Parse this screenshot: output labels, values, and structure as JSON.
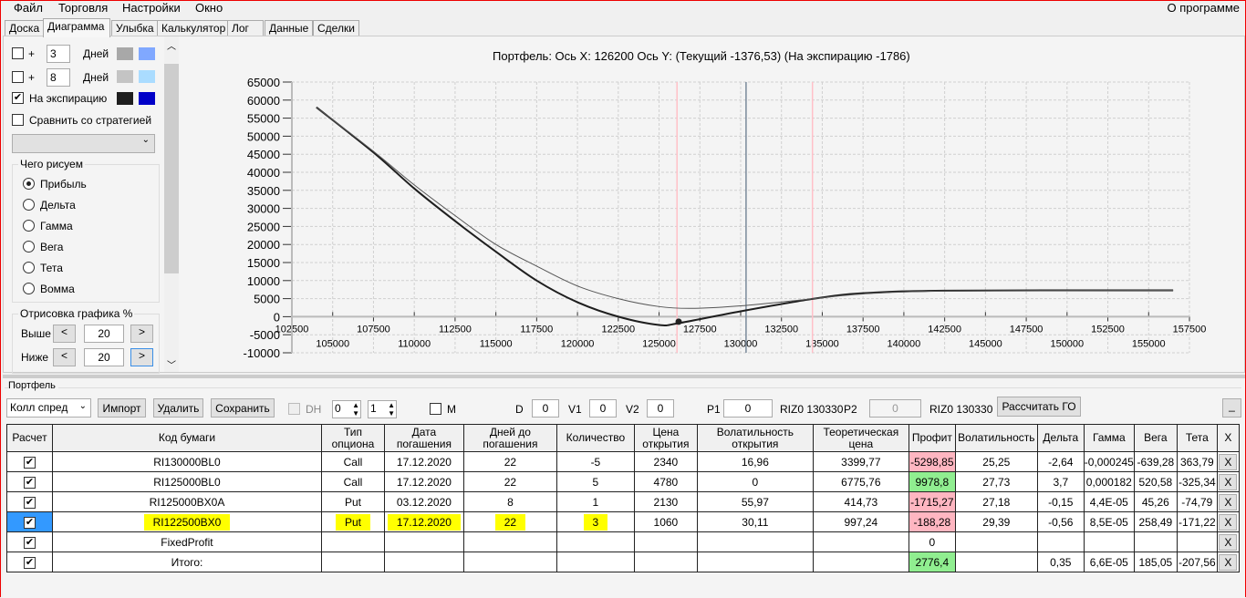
{
  "menu": {
    "items": [
      "Файл",
      "Торговля",
      "Настройки",
      "Окно"
    ],
    "about": "О программе"
  },
  "tabs": [
    "Доска",
    "Диаграмма",
    "Улыбка",
    "Калькулятор",
    "Лог",
    "Данные",
    "Сделки"
  ],
  "left": {
    "row1": {
      "checked": false,
      "plus": "+",
      "days": "3",
      "days_label": "Дней",
      "colors": [
        "#a8a8a8",
        "#80a8ff"
      ]
    },
    "row2": {
      "checked": false,
      "plus": "+",
      "days": "8",
      "days_label": "Дней",
      "colors": [
        "#c4c4c4",
        "#aadcff"
      ]
    },
    "expiration": {
      "checked": true,
      "label": "На экспирацию",
      "colors": [
        "#1e1e1e",
        "#0000c8"
      ]
    },
    "compare": {
      "checked": false,
      "label": "Сравнить со стратегией"
    },
    "strategy_select": "",
    "draw_group": "Чего рисуем",
    "draw_options": [
      "Прибыль",
      "Дельта",
      "Гамма",
      "Вега",
      "Тета",
      "Вомма"
    ],
    "draw_selected": 0,
    "range_group": "Отрисовка графика %",
    "above_label": "Выше",
    "above_value": "20",
    "below_label": "Ниже",
    "below_value": "20",
    "prev": "<",
    "next": ">"
  },
  "chart_data": {
    "type": "line",
    "title": "Портфель: Ось X: 126200 Ось Y:  (Текущий -1376,53)  (На экспирацию -1786)",
    "xlim": [
      102500,
      157500
    ],
    "ylim": [
      -10000,
      65000
    ],
    "yticks": [
      65000,
      60000,
      55000,
      50000,
      45000,
      40000,
      35000,
      30000,
      25000,
      20000,
      15000,
      10000,
      5000,
      0,
      -5000,
      -10000
    ],
    "xticks_top": [
      102500,
      107500,
      112500,
      117500,
      122500,
      127500,
      132500,
      137500,
      142500,
      147500,
      152500,
      157500
    ],
    "xticks_bottom": [
      105000,
      110000,
      115000,
      120000,
      125000,
      130000,
      135000,
      140000,
      145000,
      150000,
      155000
    ],
    "grid": true,
    "vlines": [
      {
        "x": 126100,
        "color": "#ffc0c8"
      },
      {
        "x": 134400,
        "color": "#ffc0c8"
      },
      {
        "x": 130330,
        "color": "#7a8a9a"
      }
    ],
    "marker": {
      "x": 126200,
      "y": -1376.53
    },
    "series": [
      {
        "name": "На экспирацию",
        "color": "#1e1e1e",
        "width": 2,
        "x": [
          104000,
          107500,
          110000,
          112500,
          115000,
          117500,
          120000,
          122500,
          125000,
          126200,
          130000,
          134500,
          137500,
          142500,
          156500
        ],
        "y": [
          58000,
          45500,
          35500,
          26500,
          18000,
          10000,
          4000,
          0,
          -2300,
          -1786,
          1500,
          5000,
          6500,
          7200,
          7300
        ]
      },
      {
        "name": "Текущий",
        "color": "#555555",
        "width": 1,
        "x": [
          104000,
          107500,
          110000,
          112500,
          115000,
          117500,
          120000,
          122500,
          125000,
          127000,
          130000,
          134500,
          137500,
          142500,
          156500
        ],
        "y": [
          58000,
          45800,
          36500,
          28000,
          20000,
          14000,
          8500,
          5000,
          2800,
          2300,
          3000,
          5000,
          6300,
          7100,
          7300
        ]
      }
    ]
  },
  "portfolio": {
    "label": "Портфель",
    "strategy": "Колл  спред",
    "import": "Импорт",
    "delete": "Удалить",
    "save": "Сохранить",
    "dh_label": "DH",
    "spin1": "0",
    "spin2": "1",
    "m_label": "M",
    "d_label": "D",
    "d": "0",
    "v1_label": "V1",
    "v1": "0",
    "v2_label": "V2",
    "v2": "0",
    "p1_label": "P1",
    "p1": "0",
    "p1_sec": "RIZ0 130330",
    "p2_label": "P2",
    "p2": "0",
    "p2_sec": "RIZ0 130330",
    "calc_go": "Рассчитать ГО",
    "minimize": "_"
  },
  "table": {
    "headers": [
      "Расчет",
      "Код бумаги",
      "Тип опциона",
      "Дата погашения",
      "Дней до погашения",
      "Количество",
      "Цена открытия",
      "Волатильность открытия",
      "Теоретическая цена",
      "Профит",
      "Волатильность",
      "Дельта",
      "Гамма",
      "Вега",
      "Тета",
      "X"
    ],
    "rows": [
      {
        "check": true,
        "code": "RI130000BL0",
        "type": "Call",
        "date": "17.12.2020",
        "days": "22",
        "qty": "-5",
        "open": "2340",
        "vol_open": "16,96",
        "theo": "3399,77",
        "profit": "-5298,85",
        "profit_sign": "neg",
        "vol": "25,25",
        "delta": "-2,64",
        "gamma": "-0,000245",
        "vega": "-639,28",
        "theta": "363,79",
        "x": "X"
      },
      {
        "check": true,
        "code": "RI125000BL0",
        "type": "Call",
        "date": "17.12.2020",
        "days": "22",
        "qty": "5",
        "open": "4780",
        "vol_open": "0",
        "theo": "6775,76",
        "profit": "9978,8",
        "profit_sign": "pos",
        "vol": "27,73",
        "delta": "3,7",
        "gamma": "0,000182",
        "vega": "520,58",
        "theta": "-325,34",
        "x": "X"
      },
      {
        "check": true,
        "code": "RI125000BX0A",
        "type": "Put",
        "date": "03.12.2020",
        "days": "8",
        "qty": "1",
        "open": "2130",
        "vol_open": "55,97",
        "theo": "414,73",
        "profit": "-1715,27",
        "profit_sign": "neg",
        "vol": "27,18",
        "delta": "-0,15",
        "gamma": "4,4E-05",
        "vega": "45,26",
        "theta": "-74,79",
        "x": "X"
      },
      {
        "check": true,
        "selected": true,
        "highlight": true,
        "code": "RI122500BX0",
        "type": "Put",
        "date": "17.12.2020",
        "days": "22",
        "qty": "3",
        "open": "1060",
        "vol_open": "30,11",
        "theo": "997,24",
        "profit": "-188,28",
        "profit_sign": "neg",
        "vol": "29,39",
        "delta": "-0,56",
        "gamma": "8,5E-05",
        "vega": "258,49",
        "theta": "-171,22",
        "x": "X"
      },
      {
        "check": true,
        "code": "FixedProfit",
        "type": "",
        "date": "",
        "days": "",
        "qty": "",
        "open": "",
        "vol_open": "",
        "theo": "",
        "profit": "0",
        "profit_sign": "",
        "vol": "",
        "delta": "",
        "gamma": "",
        "vega": "",
        "theta": "",
        "x": "X"
      },
      {
        "check": true,
        "code": "Итого:",
        "type": "",
        "date": "",
        "days": "",
        "qty": "",
        "open": "",
        "vol_open": "",
        "theo": "",
        "profit": "2776,4",
        "profit_sign": "pos",
        "vol": "",
        "delta": "0,35",
        "gamma": "6,6E-05",
        "vega": "185,05",
        "theta": "-207,56",
        "x": "X"
      }
    ]
  }
}
